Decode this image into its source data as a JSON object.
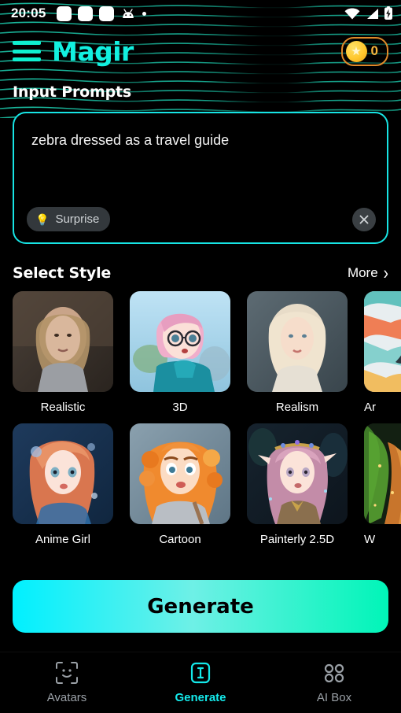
{
  "status_bar": {
    "time": "20:05",
    "left_icons": [
      "notification-square",
      "notification-square",
      "notification-square",
      "android-icon",
      "dot-icon"
    ],
    "right_icons": [
      "wifi-icon",
      "cellular-signal-icon",
      "battery-charging-icon"
    ]
  },
  "header": {
    "menu_icon": "hamburger-menu-icon",
    "brand": "Magir",
    "coin_icon": "star-coin-icon",
    "coin_count": "0",
    "brand_color": "#12f0e0",
    "coin_border_color": "#e08a2a"
  },
  "prompt_section": {
    "title": "Input Prompts",
    "value": "zebra dressed as a travel guide",
    "placeholder": "Input Prompts",
    "surprise_label": "Surprise",
    "surprise_icon": "lightbulb-icon",
    "clear_icon": "close-icon",
    "border_color": "#17e4e4"
  },
  "style_section": {
    "title": "Select Style",
    "more_label": "More",
    "more_icon": "chevron-right-icon",
    "rows": [
      [
        {
          "label": "Realistic",
          "clipped": false
        },
        {
          "label": "3D",
          "clipped": false
        },
        {
          "label": "Realism",
          "clipped": false
        },
        {
          "label": "Ar",
          "clipped": true
        }
      ],
      [
        {
          "label": "Anime Girl",
          "clipped": false
        },
        {
          "label": "Cartoon",
          "clipped": false
        },
        {
          "label": "Painterly 2.5D",
          "clipped": false
        },
        {
          "label": "W",
          "clipped": true
        }
      ]
    ]
  },
  "generate": {
    "label": "Generate",
    "gradient_from": "#00f0ff",
    "gradient_mid": "#7ff5e8",
    "gradient_to": "#00f5b8"
  },
  "bottom_nav": {
    "active_color": "#14e9ea",
    "inactive_color": "#9aa0a6",
    "items": [
      {
        "label": "Avatars",
        "icon": "face-scan-icon",
        "active": false
      },
      {
        "label": "Generate",
        "icon": "text-cursor-box-icon",
        "active": true
      },
      {
        "label": "AI Box",
        "icon": "grid-four-squares-icon",
        "active": false
      }
    ]
  }
}
